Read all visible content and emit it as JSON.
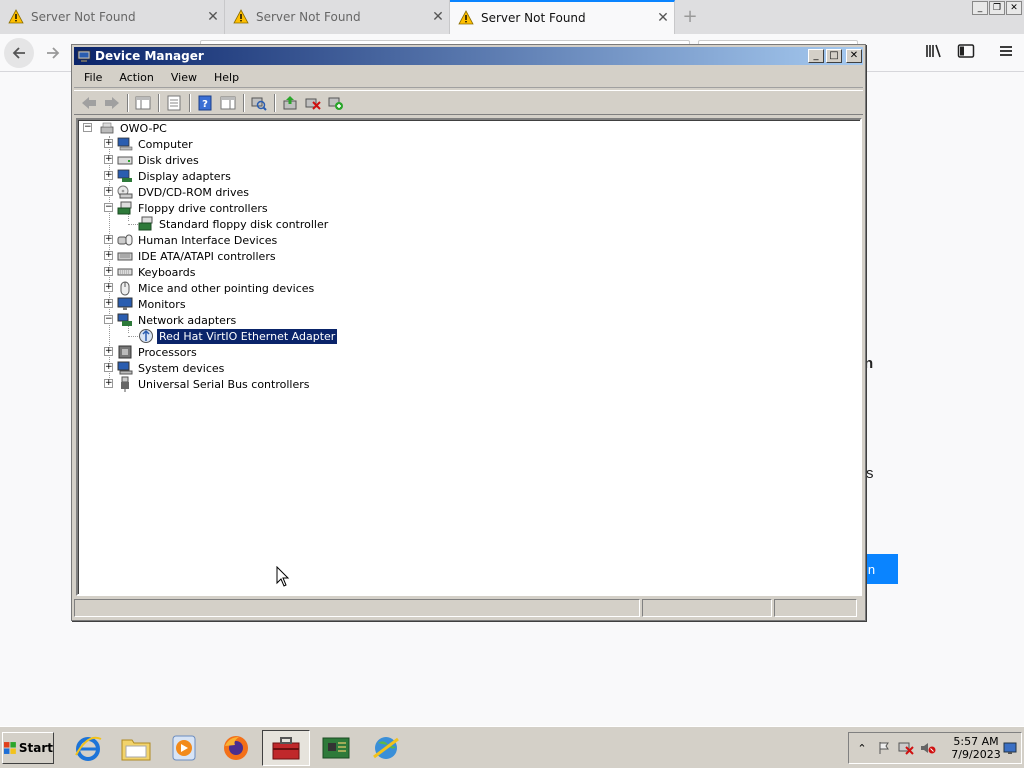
{
  "browser": {
    "tabs": [
      {
        "title": "Server Not Found",
        "active": false
      },
      {
        "title": "Server Not Found",
        "active": false
      },
      {
        "title": "Server Not Found",
        "active": true
      }
    ],
    "newtab_symbol": "+",
    "content_fragments": {
      "n": "n",
      "s": "s",
      "button": "in"
    }
  },
  "device_manager": {
    "title": "Device Manager",
    "menu": [
      "File",
      "Action",
      "View",
      "Help"
    ],
    "root": "OWO-PC",
    "nodes": [
      {
        "label": "Computer",
        "expanded": false,
        "icon": "computer-icon"
      },
      {
        "label": "Disk drives",
        "expanded": false,
        "icon": "disk-drive-icon"
      },
      {
        "label": "Display adapters",
        "expanded": false,
        "icon": "display-adapter-icon"
      },
      {
        "label": "DVD/CD-ROM drives",
        "expanded": false,
        "icon": "dvd-drive-icon"
      },
      {
        "label": "Floppy drive controllers",
        "expanded": true,
        "icon": "floppy-controller-icon",
        "children": [
          {
            "label": "Standard floppy disk controller",
            "selected": false
          }
        ]
      },
      {
        "label": "Human Interface Devices",
        "expanded": false,
        "icon": "hid-icon"
      },
      {
        "label": "IDE ATA/ATAPI controllers",
        "expanded": false,
        "icon": "ide-controller-icon"
      },
      {
        "label": "Keyboards",
        "expanded": false,
        "icon": "keyboard-icon"
      },
      {
        "label": "Mice and other pointing devices",
        "expanded": false,
        "icon": "mouse-icon"
      },
      {
        "label": "Monitors",
        "expanded": false,
        "icon": "monitor-icon"
      },
      {
        "label": "Network adapters",
        "expanded": true,
        "icon": "network-adapter-icon",
        "children": [
          {
            "label": "Red Hat VirtIO Ethernet Adapter",
            "selected": true
          }
        ]
      },
      {
        "label": "Processors",
        "expanded": false,
        "icon": "processor-icon"
      },
      {
        "label": "System devices",
        "expanded": false,
        "icon": "system-devices-icon"
      },
      {
        "label": "Universal Serial Bus controllers",
        "expanded": false,
        "icon": "usb-icon"
      }
    ]
  },
  "taskbar": {
    "start_label": "Start",
    "clock_time": "5:57 AM",
    "clock_date": "7/9/2023"
  },
  "colors": {
    "selection": "#0a246a",
    "firefox_accent": "#0a84ff",
    "classic_face": "#d4d0c8"
  }
}
